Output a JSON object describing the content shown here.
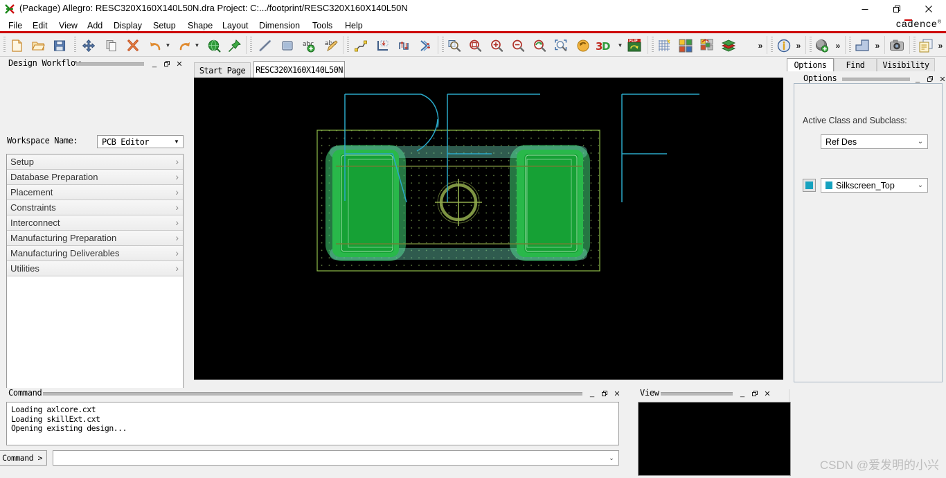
{
  "window": {
    "title": "(Package) Allegro: RESC320X160X140L50N.dra  Project: C:.../footprint/RESC320X160X140L50N",
    "app_icon": "allegro-icon",
    "minimize": "–",
    "maximize": "❐",
    "close": "✕",
    "brand": "cadence"
  },
  "menu": {
    "items": [
      {
        "label": "File",
        "accel": "F"
      },
      {
        "label": "Edit",
        "accel": "E"
      },
      {
        "label": "View",
        "accel": "V"
      },
      {
        "label": "Add",
        "accel": "A"
      },
      {
        "label": "Display",
        "accel": "D"
      },
      {
        "label": "Setup",
        "accel": "u"
      },
      {
        "label": "Shape",
        "accel": "S"
      },
      {
        "label": "Layout",
        "accel": "L"
      },
      {
        "label": "Dimension",
        "accel": "i"
      },
      {
        "label": "Tools",
        "accel": "T"
      },
      {
        "label": "Help",
        "accel": "H"
      }
    ]
  },
  "toolbar": {
    "buttons": [
      {
        "name": "new-icon",
        "tip": "New"
      },
      {
        "name": "open-folder-icon",
        "tip": "Open"
      },
      {
        "name": "save-icon",
        "tip": "Save"
      },
      {
        "name": "move-icon",
        "tip": "Move"
      },
      {
        "name": "copy-icon",
        "tip": "Copy"
      },
      {
        "name": "delete-icon",
        "tip": "Delete"
      },
      {
        "name": "undo-icon",
        "tip": "Undo"
      },
      {
        "name": "redo-icon",
        "tip": "Redo"
      },
      {
        "name": "globe-icon",
        "tip": "Net Schedule"
      },
      {
        "name": "pin-icon",
        "tip": "Pin"
      },
      {
        "name": "line-icon",
        "tip": "Add Line"
      },
      {
        "name": "rectangle-icon",
        "tip": "Shape Add Rect"
      },
      {
        "name": "add-text-icon",
        "tip": "Add Text"
      },
      {
        "name": "edit-text-icon",
        "tip": "Edit Text"
      },
      {
        "name": "add-connect-icon",
        "tip": "Add Connect"
      },
      {
        "name": "slide-icon",
        "tip": "Slide"
      },
      {
        "name": "delay-tune-icon",
        "tip": "Delay Tune"
      },
      {
        "name": "contour-icon",
        "tip": "Contour"
      },
      {
        "name": "zoom-by-points-icon",
        "tip": "Zoom By Points"
      },
      {
        "name": "zoom-fit-icon",
        "tip": "Zoom Fit"
      },
      {
        "name": "zoom-in-icon",
        "tip": "Zoom In"
      },
      {
        "name": "zoom-out-icon",
        "tip": "Zoom Out"
      },
      {
        "name": "zoom-previous-icon",
        "tip": "Zoom Previous"
      },
      {
        "name": "zoom-selection-icon",
        "tip": "Zoom Selection"
      },
      {
        "name": "refresh-icon",
        "tip": "Redraw"
      },
      {
        "name": "three-d-view-icon",
        "tip": "3D Canvas"
      },
      {
        "name": "flip-design-icon",
        "tip": "Flip Design"
      },
      {
        "name": "grid-toggle-icon",
        "tip": "Grid Toggle"
      },
      {
        "name": "color-palette-icon",
        "tip": "Color/Visibility"
      },
      {
        "name": "color-assign-icon",
        "tip": "Assign Color"
      },
      {
        "name": "subclass-stack-icon",
        "tip": "Layer Stack"
      },
      {
        "name": "info-icon",
        "tip": "Show Element"
      },
      {
        "name": "add-via-icon",
        "tip": "Add Via"
      },
      {
        "name": "shape-icon",
        "tip": "Shape"
      },
      {
        "name": "camera-icon",
        "tip": "Snapshot"
      },
      {
        "name": "reports-icon",
        "tip": "Reports"
      }
    ],
    "overflow_glyph": "»"
  },
  "design_workflow": {
    "title": "Design Workflow",
    "controls": {
      "minimize": "_",
      "restore": "❐",
      "close": "✕"
    },
    "workspace_label": "Workspace Name:",
    "workspace_value": "PCB Editor",
    "items": [
      {
        "label": "Setup"
      },
      {
        "label": "Database Preparation"
      },
      {
        "label": "Placement"
      },
      {
        "label": "Constraints"
      },
      {
        "label": "Interconnect"
      },
      {
        "label": "Manufacturing Preparation"
      },
      {
        "label": "Manufacturing Deliverables"
      },
      {
        "label": "Utilities"
      }
    ],
    "chevron": "›"
  },
  "tabs": [
    {
      "label": "Start Page",
      "active": false
    },
    {
      "label": "RESC320X160X140L50N",
      "active": true
    }
  ],
  "canvas": {
    "background": "#000000",
    "colors": {
      "package_boundary": "#8fbf4a",
      "grid_dots": "#5f7f3f",
      "pad_outer": "#2fb24c",
      "pad_inner": "#1f9e3a",
      "soldermask": "#63c08e",
      "silkscreen": "#2aa8c8",
      "assembly_outline": "#7a8f3c",
      "origin_marker": "#9bb84e"
    }
  },
  "command_dock": {
    "title": "Command",
    "controls": {
      "minimize": "_",
      "restore": "❐",
      "close": "✕"
    },
    "log": [
      "Loading axlcore.cxt",
      "Loading skillExt.cxt",
      "Opening existing design..."
    ],
    "prompt": "Command >",
    "input_value": "",
    "input_placeholder": "",
    "dropdown_glyph": "⌄"
  },
  "view_dock": {
    "title": "View",
    "controls": {
      "minimize": "_",
      "restore": "❐",
      "close": "✕"
    }
  },
  "right_dock": {
    "tabs": [
      {
        "label": "Options",
        "active": true
      },
      {
        "label": "Find",
        "active": false
      },
      {
        "label": "Visibility",
        "active": false
      }
    ],
    "panel_title": "Options",
    "controls": {
      "minimize": "_",
      "restore": "❐",
      "close": "✕"
    },
    "active_class_label": "Active Class and Subclass:",
    "class_value": "Ref Des",
    "subclass_value": "Silkscreen_Top",
    "subclass_color": "#17a2bf",
    "dropdown_glyph": "⌄"
  },
  "watermark": "CSDN @爱发明的小兴"
}
